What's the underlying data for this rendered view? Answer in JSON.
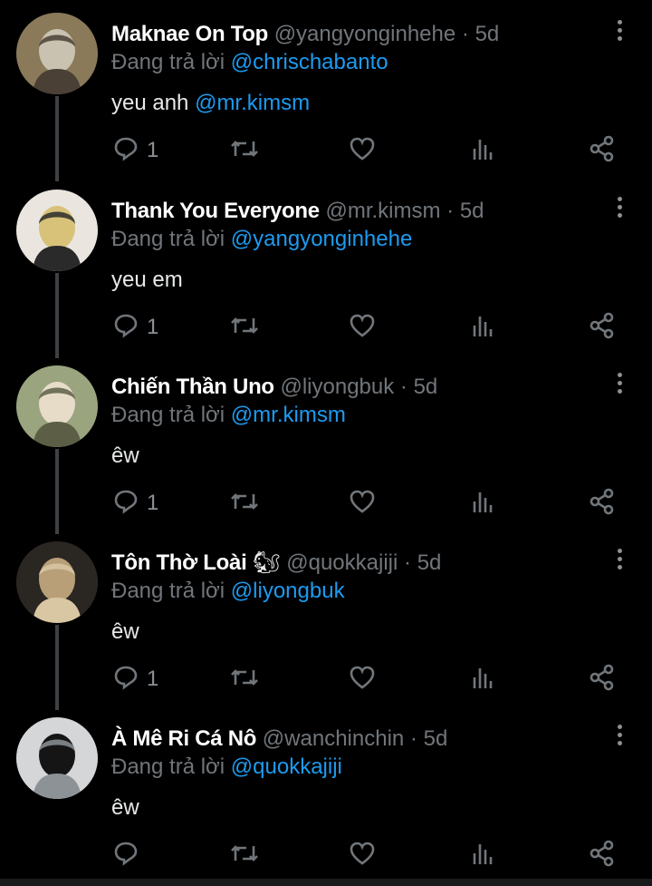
{
  "tweets": [
    {
      "name": "Maknae On Top",
      "emoji": "",
      "handle": "@yangyonginhehe",
      "time": "5d",
      "reply_prefix": "Đang trả lời",
      "reply_to": "@chrischabanto",
      "text": "yeu anh ",
      "text_mention": "@mr.kimsm",
      "reply_count": "1",
      "avatar_colors": [
        "#8a7a5a",
        "#c9c2b0",
        "#4a4036"
      ]
    },
    {
      "name": "Thank You Everyone",
      "emoji": "",
      "handle": "@mr.kimsm",
      "time": "5d",
      "reply_prefix": "Đang trả lời",
      "reply_to": "@yangyonginhehe",
      "text": "yeu em",
      "text_mention": "",
      "reply_count": "1",
      "avatar_colors": [
        "#eae6df",
        "#d8c27a",
        "#2a2a2a"
      ]
    },
    {
      "name": "Chiến Thần Uno",
      "emoji": "",
      "handle": "@liyongbuk",
      "time": "5d",
      "reply_prefix": "Đang trả lời",
      "reply_to": "@mr.kimsm",
      "text": "êw",
      "text_mention": "",
      "reply_count": "1",
      "avatar_colors": [
        "#9aa47f",
        "#e7dcc8",
        "#5c5f45"
      ]
    },
    {
      "name": "Tôn Thờ Loài",
      "emoji": "🐿",
      "handle": "@quokkajiji",
      "time": "5d",
      "reply_prefix": "Đang trả lời",
      "reply_to": "@liyongbuk",
      "text": "êw",
      "text_mention": "",
      "reply_count": "1",
      "avatar_colors": [
        "#2a2622",
        "#b89f78",
        "#d9c7a4"
      ]
    },
    {
      "name": "À Mê Ri Cá Nô",
      "emoji": "",
      "handle": "@wanchinchin",
      "time": "5d",
      "reply_prefix": "Đang trả lời",
      "reply_to": "@quokkajiji",
      "text": "êw",
      "text_mention": "",
      "reply_count": "",
      "avatar_colors": [
        "#d4d6d8",
        "#151515",
        "#8c9296"
      ]
    }
  ],
  "icons": {
    "reply": "speech-bubble-icon",
    "retweet": "retweet-icon",
    "like": "heart-icon",
    "views": "bar-chart-icon",
    "share": "share-icon",
    "more": "vertical-ellipsis-icon"
  },
  "colors": {
    "background": "#000000",
    "accent": "#1d9bf0",
    "muted": "#71767b",
    "name": "#ffffff"
  }
}
